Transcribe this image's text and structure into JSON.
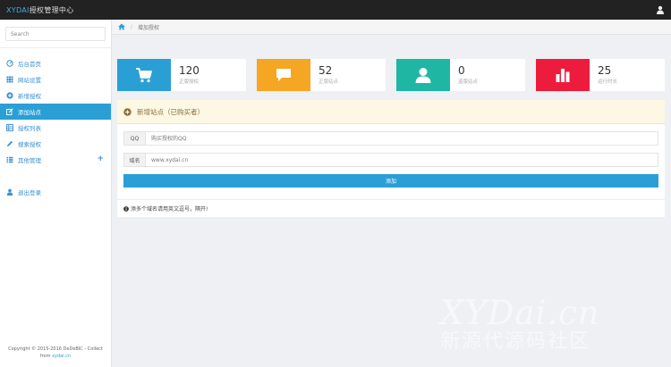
{
  "header": {
    "brand_prefix": "XYDAI",
    "brand_suffix": "授权管理中心"
  },
  "search": {
    "placeholder": "Search"
  },
  "sidebar": {
    "items": [
      {
        "label": "后台首页",
        "icon": "dashboard-icon"
      },
      {
        "label": "网站设置",
        "icon": "grid-icon"
      },
      {
        "label": "新增授权",
        "icon": "plus-circle-icon"
      },
      {
        "label": "添加站点",
        "icon": "edit-icon",
        "active": true
      },
      {
        "label": "授权列表",
        "icon": "list-icon"
      },
      {
        "label": "搜索授权",
        "icon": "pencil-icon"
      },
      {
        "label": "其他管理",
        "icon": "list-icon",
        "expand": "+"
      }
    ],
    "logout_label": "退出登录",
    "copyright_line1": "Copyright © 2015-2016 DeDeBIC - Collect",
    "copyright_from": "from",
    "copyright_link": "xydai.cn"
  },
  "breadcrumb": {
    "current": "增加授权"
  },
  "stats": [
    {
      "value": "120",
      "label": "正版授权",
      "color": "#2a9fd6",
      "icon": "cart-icon"
    },
    {
      "value": "52",
      "label": "正版站点",
      "color": "#f5a623",
      "icon": "chat-icon"
    },
    {
      "value": "0",
      "label": "盗版站点",
      "color": "#1fb6a3",
      "icon": "user-icon"
    },
    {
      "value": "25",
      "label": "运行时长",
      "color": "#ee1c3c",
      "icon": "bar-chart-icon"
    }
  ],
  "form": {
    "title": "新增站点（已购买者）",
    "qq_label": "QQ",
    "qq_placeholder": "购买授权的QQ",
    "domain_label": "域名",
    "domain_placeholder": "www.xydai.cn",
    "submit_label": "添加",
    "note": "添多个域名请用英文逗号，隔开!"
  },
  "watermark": {
    "line1": "XYDai.cn",
    "line2": "新源代源码社区"
  },
  "colors": {
    "accent": "#2a9fd6",
    "topbar": "#222222",
    "notice_bg": "#fcf8e3"
  }
}
